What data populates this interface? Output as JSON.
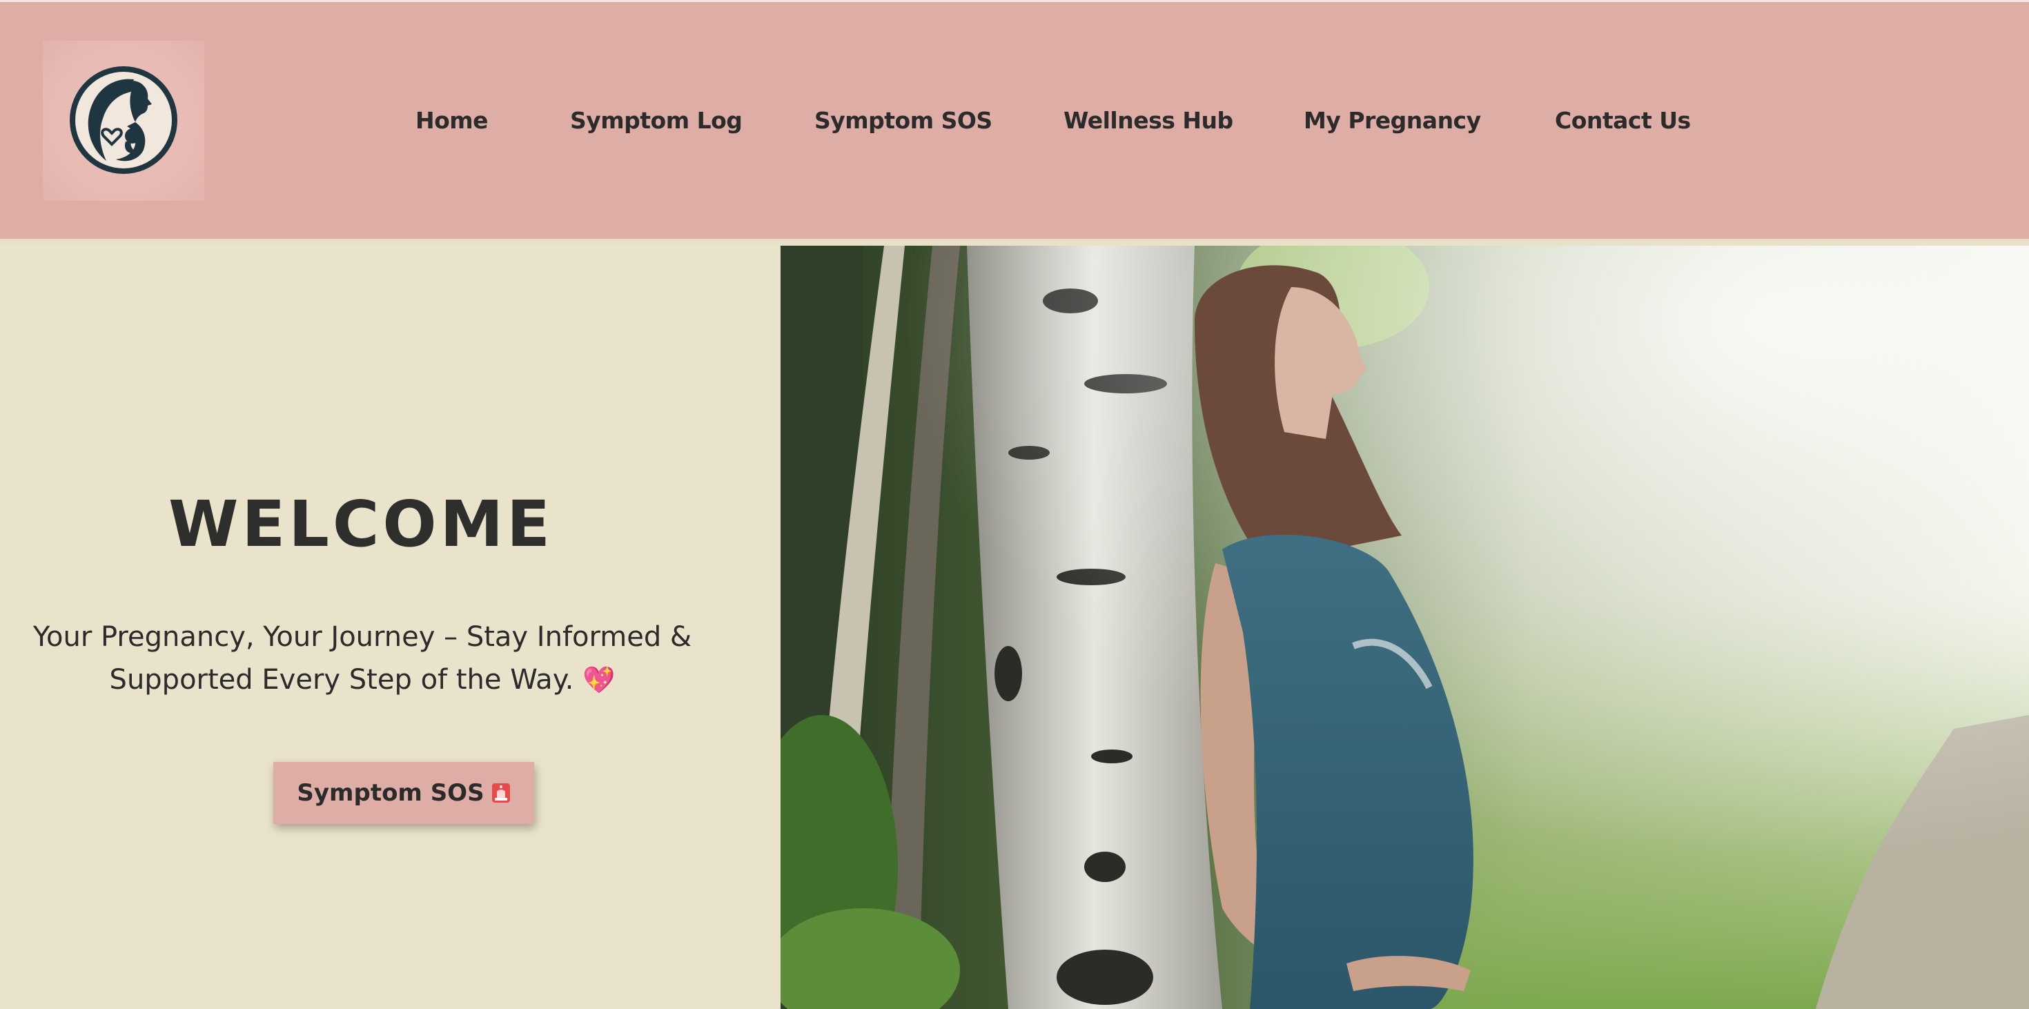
{
  "nav": {
    "items": [
      {
        "label": "Home"
      },
      {
        "label": "Symptom Log"
      },
      {
        "label": "Symptom SOS"
      },
      {
        "label": "Wellness Hub"
      },
      {
        "label": "My Pregnancy"
      },
      {
        "label": "Contact Us"
      }
    ]
  },
  "hero": {
    "title": "WELCOME",
    "tagline_line1": "Your Pregnancy, Your Journey – Stay Informed &",
    "tagline_line2": "Supported Every Step of the Way.",
    "tagline_emoji": "💖",
    "cta_label": "Symptom SOS",
    "cta_icon": "siren-icon",
    "image_icon": "pregnant-woman-forest-photo"
  },
  "colors": {
    "header_bg": "#deaea6",
    "page_bg": "#e9e3cb",
    "text": "#2b2b2b",
    "logo_navy": "#1f3540"
  }
}
